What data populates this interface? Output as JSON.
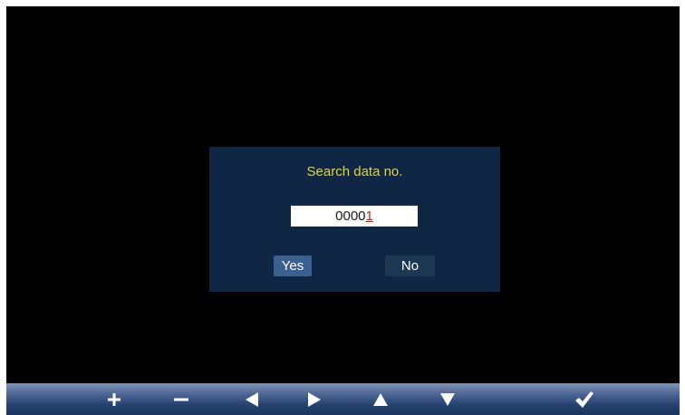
{
  "dialog": {
    "title": "Search data no.",
    "number_prefix": "0000",
    "number_cursor_digit": "1",
    "yes_label": "Yes",
    "no_label": "No"
  },
  "toolbar": {
    "buttons": [
      {
        "icon": "plus-icon"
      },
      {
        "icon": "minus-icon"
      },
      {
        "icon": "arrow-left-icon"
      },
      {
        "icon": "arrow-right-icon"
      },
      {
        "icon": "arrow-up-icon"
      },
      {
        "icon": "arrow-down-icon"
      },
      {
        "icon": "checkmark-icon"
      }
    ]
  },
  "colors": {
    "screen_background": "#000000",
    "dialog_background": "#0f2745",
    "title_text": "#e0d341",
    "cursor_digit": "#d12020",
    "selected_button": "#3b5f8f",
    "unselected_button": "#1d3852"
  }
}
